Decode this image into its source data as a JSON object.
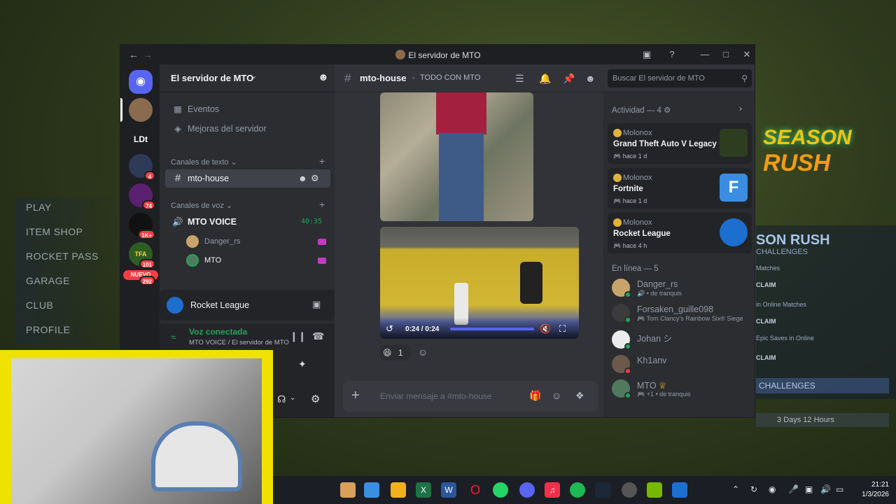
{
  "background": {
    "menu": [
      "PLAY",
      "ITEM SHOP",
      "ROCKET PASS",
      "GARAGE",
      "CLUB",
      "PROFILE"
    ],
    "season_logo_1": "SEASON",
    "season_logo_2": "RUSH",
    "panel_title": "SON RUSH",
    "panel_sub": "CHALLENGES",
    "rows": [
      "Matches",
      "in Online Matches",
      "Epic Saves in Online"
    ],
    "claim": "CLAIM",
    "challenges": "CHALLENGES",
    "days": "3 Days 12 Hours"
  },
  "window": {
    "title": "El servidor de MTO"
  },
  "rail": {
    "servers": [
      {
        "label": "",
        "badge": ""
      },
      {
        "label": "LDt",
        "badge": ""
      },
      {
        "label": "",
        "badge": "4"
      },
      {
        "label": "",
        "badge": "74"
      },
      {
        "label": "",
        "badge": "1K+"
      },
      {
        "label": "TFA",
        "badge": "101"
      },
      {
        "label": "NUEVO",
        "badge": "292"
      }
    ]
  },
  "sidebar": {
    "server_name": "El servidor de MTO",
    "events": "Eventos",
    "boosts": "Mejoras del servidor",
    "text_category": "Canales de texto",
    "text_channel": "mto-house",
    "voice_category": "Canales de voz",
    "voice_channel": "MTO VOICE",
    "voice_timer": "40:35",
    "voice_users": [
      "Danger_rs",
      "MTO"
    ]
  },
  "activity_card": {
    "game": "Rocket League"
  },
  "voice_panel": {
    "status": "Voz conectada",
    "location": "MTO VOICE / El servidor de MTO"
  },
  "chat_header": {
    "channel": "mto-house",
    "topic": "TODO CON MTO",
    "search_placeholder": "Buscar El servidor de MTO"
  },
  "chat": {
    "video_time": "0:24 / 0:24",
    "video_progress": 1.0,
    "reaction_count": "1",
    "composer_placeholder": "Enviar mensaje a #mto-house"
  },
  "members": {
    "activity_header": "Actividad — 4",
    "activities": [
      {
        "user": "Molonox",
        "game": "Grand Theft Auto V Legacy",
        "time": "hace 1 d",
        "icon_color": "#2c3e1f"
      },
      {
        "user": "Molonox",
        "game": "Fortnite",
        "time": "hace 1 d",
        "icon_color": "#3a8de0"
      },
      {
        "user": "Molonox",
        "game": "Rocket League",
        "time": "hace 4 h",
        "icon_color": "#1c6fcf"
      }
    ],
    "online_header": "En línea — 5",
    "online": [
      {
        "name": "Danger_rs",
        "status": "de tranquis",
        "dot": "#23a55a",
        "avatar": "#c9a46a"
      },
      {
        "name": "Forsaken_guille098",
        "status": "Tom Clancy's Rainbow Six® Siege",
        "dot": "#23a55a",
        "avatar": "#3b3b3b"
      },
      {
        "name": "Johan シ",
        "status": "",
        "dot": "#23a55a",
        "avatar": "#ececec"
      },
      {
        "name": "Kh1anv",
        "status": "",
        "dot": "#f23f43",
        "avatar": "#6b5a4c"
      },
      {
        "name": "MTO",
        "status": "de tranquis",
        "dot": "#23a55a",
        "avatar": "#4f7a5e"
      }
    ]
  },
  "taskbar": {
    "time": "21:21",
    "date": "1/3/2026"
  }
}
